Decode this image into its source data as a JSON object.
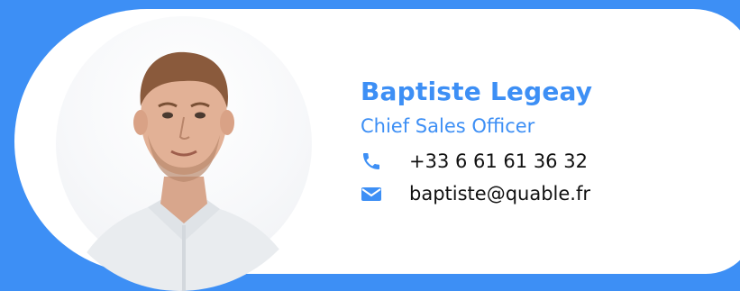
{
  "profile": {
    "name": "Baptiste Legeay",
    "title": "Chief Sales Officer",
    "phone": "+33 6 61 61 36 32",
    "email": "baptiste@quable.fr"
  },
  "icons": {
    "phone": "phone-icon",
    "email": "envelope-icon"
  },
  "colors": {
    "brand": "#3d8ff5",
    "card": "#ffffff",
    "text": "#111111"
  }
}
